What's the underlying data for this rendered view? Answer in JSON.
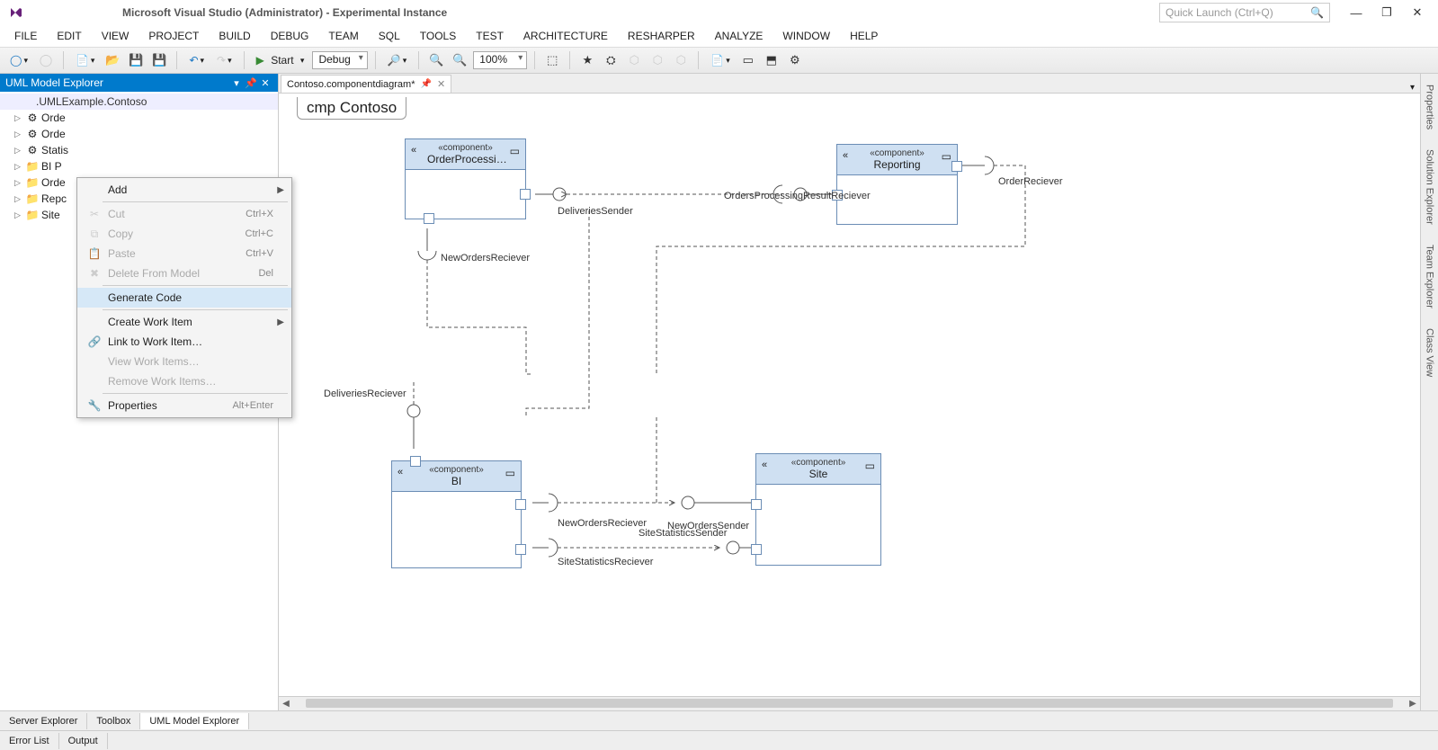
{
  "title": "Microsoft Visual Studio (Administrator) - Experimental Instance",
  "quick_launch_placeholder": "Quick Launch (Ctrl+Q)",
  "menu": [
    "FILE",
    "EDIT",
    "VIEW",
    "PROJECT",
    "BUILD",
    "DEBUG",
    "TEAM",
    "SQL",
    "TOOLS",
    "TEST",
    "ARCHITECTURE",
    "RESHARPER",
    "ANALYZE",
    "WINDOW",
    "HELP"
  ],
  "toolbar": {
    "start": "Start",
    "config": "Debug",
    "zoom": "100%"
  },
  "left_panel": {
    "title": "UML Model Explorer",
    "breadcrumb": ".UMLExample.Contoso",
    "tree": [
      {
        "label": "Orde",
        "icon": "⚙"
      },
      {
        "label": "Orde",
        "icon": "⚙"
      },
      {
        "label": "Statis",
        "icon": "⚙"
      },
      {
        "label": "BI P",
        "icon": "📁"
      },
      {
        "label": "Orde",
        "icon": "📁"
      },
      {
        "label": "Repc",
        "icon": "📁"
      },
      {
        "label": "Site",
        "icon": "📁"
      }
    ]
  },
  "context_menu": [
    {
      "label": "Add",
      "shortcut": "",
      "submenu": true,
      "disabled": false,
      "icon": ""
    },
    {
      "sep": true
    },
    {
      "label": "Cut",
      "shortcut": "Ctrl+X",
      "disabled": true,
      "icon": "✂"
    },
    {
      "label": "Copy",
      "shortcut": "Ctrl+C",
      "disabled": true,
      "icon": "⧉"
    },
    {
      "label": "Paste",
      "shortcut": "Ctrl+V",
      "disabled": true,
      "icon": "📋"
    },
    {
      "label": "Delete From Model",
      "shortcut": "Del",
      "disabled": true,
      "icon": "✖"
    },
    {
      "sep": true
    },
    {
      "label": "Generate Code",
      "shortcut": "",
      "disabled": false,
      "hover": true,
      "icon": ""
    },
    {
      "sep": true
    },
    {
      "label": "Create Work Item",
      "shortcut": "",
      "submenu": true,
      "disabled": false,
      "icon": ""
    },
    {
      "label": "Link to Work Item…",
      "shortcut": "",
      "disabled": false,
      "icon": "🔗"
    },
    {
      "label": "View Work Items…",
      "shortcut": "",
      "disabled": true,
      "icon": ""
    },
    {
      "label": "Remove Work Items…",
      "shortcut": "",
      "disabled": true,
      "icon": ""
    },
    {
      "sep": true
    },
    {
      "label": "Properties",
      "shortcut": "Alt+Enter",
      "disabled": false,
      "icon": "🔧"
    }
  ],
  "doc_tab": "Contoso.componentdiagram*",
  "diagram": {
    "title": "cmp Contoso",
    "components": {
      "order": {
        "stereo": "«component»",
        "name": "OrderProcessi…"
      },
      "reporting": {
        "stereo": "«component»",
        "name": "Reporting"
      },
      "bi": {
        "stereo": "«component»",
        "name": "BI"
      },
      "site": {
        "stereo": "«component»",
        "name": "Site"
      }
    },
    "labels": {
      "deliveriesSender": "DeliveriesSender",
      "ordersProcessingResultReciever": "OrdersProcessingResultReciever",
      "orderReciever": "OrderReciever",
      "newOrdersReciever": "NewOrdersReciever",
      "deliveriesReciever": "DeliveriesReciever",
      "newOrdersReciever2": "NewOrdersReciever",
      "newOrdersSender": "NewOrdersSender",
      "siteStatisticsSender": "SiteStatisticsSender",
      "siteStatisticsReciever": "SiteStatisticsReciever"
    }
  },
  "right_tabs": [
    "Properties",
    "Solution Explorer",
    "Team Explorer",
    "Class View"
  ],
  "bottom_left_tabs": [
    "Server Explorer",
    "Toolbox",
    "UML Model Explorer"
  ],
  "bottom_tabs2": [
    "Error List",
    "Output"
  ]
}
